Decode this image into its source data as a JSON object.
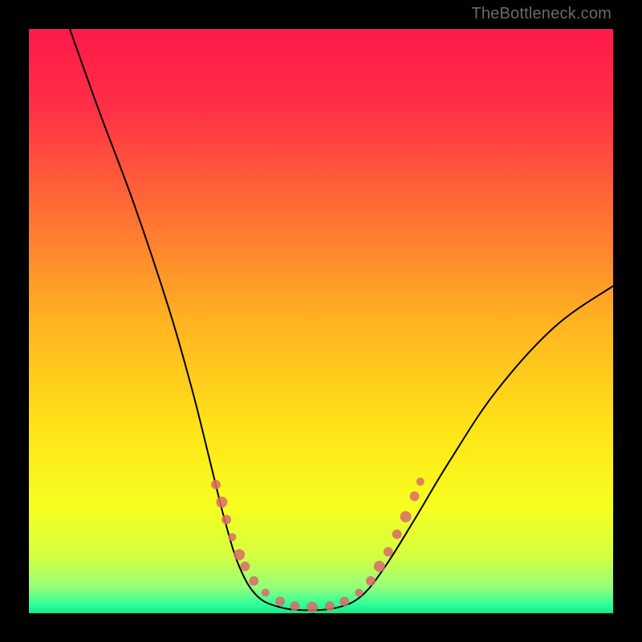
{
  "watermark": "TheBottleneck.com",
  "chart_data": {
    "type": "line",
    "title": "",
    "xlabel": "",
    "ylabel": "",
    "xlim": [
      0,
      100
    ],
    "ylim": [
      0,
      100
    ],
    "gradient_stops": [
      {
        "offset": 0.0,
        "color": "#ff1a4a"
      },
      {
        "offset": 0.13,
        "color": "#ff2e46"
      },
      {
        "offset": 0.3,
        "color": "#ff6a36"
      },
      {
        "offset": 0.5,
        "color": "#ffb321"
      },
      {
        "offset": 0.68,
        "color": "#ffe318"
      },
      {
        "offset": 0.82,
        "color": "#f6ff1f"
      },
      {
        "offset": 0.9,
        "color": "#d6ff3f"
      },
      {
        "offset": 0.955,
        "color": "#97ff7a"
      },
      {
        "offset": 0.985,
        "color": "#2fff9a"
      },
      {
        "offset": 1.0,
        "color": "#17e88a"
      }
    ],
    "series": [
      {
        "name": "bottleneck-curve",
        "points": [
          {
            "x": 7.0,
            "y": 100.0
          },
          {
            "x": 12.0,
            "y": 86.0
          },
          {
            "x": 18.0,
            "y": 70.0
          },
          {
            "x": 24.0,
            "y": 52.0
          },
          {
            "x": 28.0,
            "y": 38.0
          },
          {
            "x": 31.0,
            "y": 26.0
          },
          {
            "x": 33.5,
            "y": 16.0
          },
          {
            "x": 36.0,
            "y": 8.0
          },
          {
            "x": 39.0,
            "y": 3.0
          },
          {
            "x": 43.0,
            "y": 1.0
          },
          {
            "x": 48.0,
            "y": 0.5
          },
          {
            "x": 53.0,
            "y": 1.0
          },
          {
            "x": 57.0,
            "y": 3.0
          },
          {
            "x": 61.0,
            "y": 8.0
          },
          {
            "x": 66.0,
            "y": 16.0
          },
          {
            "x": 72.0,
            "y": 26.0
          },
          {
            "x": 80.0,
            "y": 38.0
          },
          {
            "x": 90.0,
            "y": 49.0
          },
          {
            "x": 100.0,
            "y": 56.0
          }
        ]
      }
    ],
    "markers": {
      "name": "data-points",
      "color": "#d86b6b",
      "radius_range": [
        4,
        8
      ],
      "points": [
        {
          "x": 32.0,
          "y": 22.0,
          "r": 6
        },
        {
          "x": 33.0,
          "y": 19.0,
          "r": 7
        },
        {
          "x": 33.8,
          "y": 16.0,
          "r": 6
        },
        {
          "x": 34.8,
          "y": 13.0,
          "r": 5
        },
        {
          "x": 36.0,
          "y": 10.0,
          "r": 7
        },
        {
          "x": 37.0,
          "y": 8.0,
          "r": 6
        },
        {
          "x": 38.5,
          "y": 5.5,
          "r": 6
        },
        {
          "x": 40.5,
          "y": 3.5,
          "r": 5
        },
        {
          "x": 43.0,
          "y": 2.0,
          "r": 6
        },
        {
          "x": 45.5,
          "y": 1.2,
          "r": 6
        },
        {
          "x": 48.5,
          "y": 1.0,
          "r": 7
        },
        {
          "x": 51.5,
          "y": 1.2,
          "r": 6
        },
        {
          "x": 54.0,
          "y": 2.0,
          "r": 6
        },
        {
          "x": 56.5,
          "y": 3.5,
          "r": 5
        },
        {
          "x": 58.5,
          "y": 5.5,
          "r": 6
        },
        {
          "x": 60.0,
          "y": 8.0,
          "r": 7
        },
        {
          "x": 61.5,
          "y": 10.5,
          "r": 6
        },
        {
          "x": 63.0,
          "y": 13.5,
          "r": 6
        },
        {
          "x": 64.5,
          "y": 16.5,
          "r": 7
        },
        {
          "x": 66.0,
          "y": 20.0,
          "r": 6
        },
        {
          "x": 67.0,
          "y": 22.5,
          "r": 5
        }
      ]
    }
  }
}
